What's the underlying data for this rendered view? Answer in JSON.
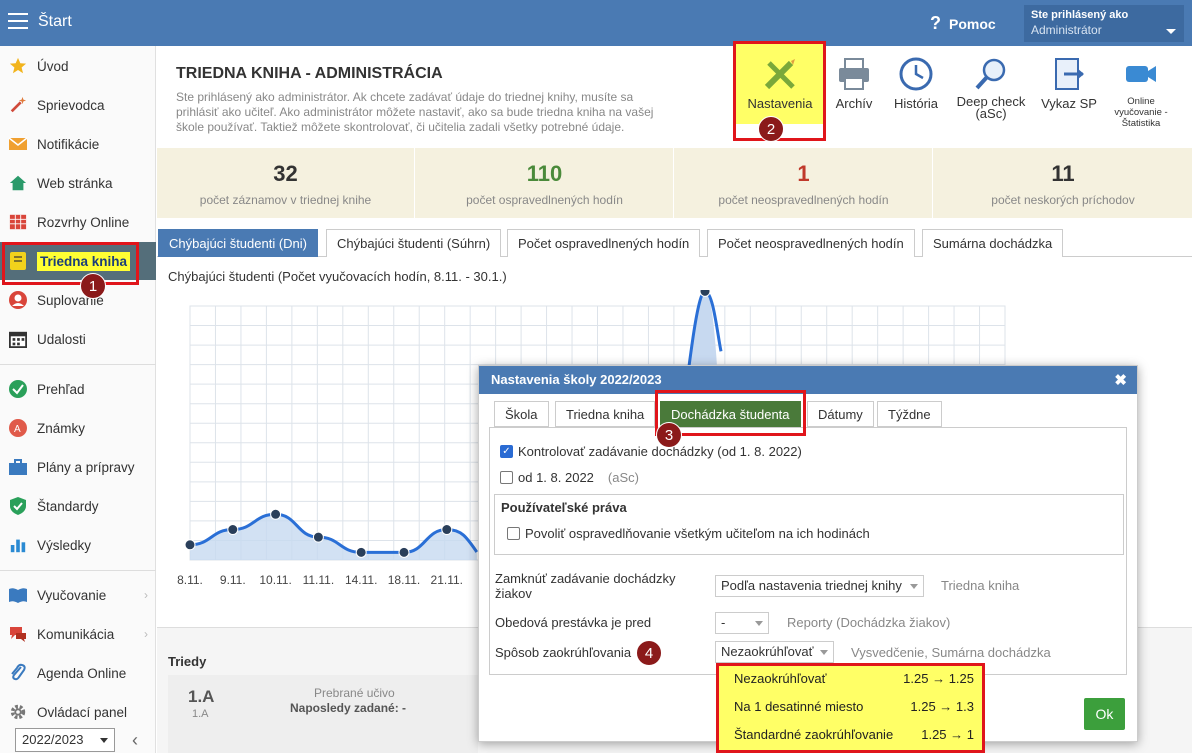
{
  "app": {
    "title": "Štart",
    "help": "Pomoc",
    "user_label": "Ste prihlásený ako",
    "user_role": "Administrátor"
  },
  "sidebar": {
    "items": [
      {
        "label": "Úvod",
        "icon": "star-icon"
      },
      {
        "label": "Sprievodca",
        "icon": "wand-icon"
      },
      {
        "label": "Notifikácie",
        "icon": "envelope-icon"
      },
      {
        "label": "Web stránka",
        "icon": "home-icon"
      },
      {
        "label": "Rozvrhy Online",
        "icon": "calendar-grid-icon"
      },
      {
        "label": "Triedna kniha",
        "icon": "notebook-icon"
      },
      {
        "label": "Suplovanie",
        "icon": "person-icon"
      },
      {
        "label": "Udalosti",
        "icon": "calendar-icon"
      },
      {
        "label": "Prehľad",
        "icon": "check-circle-icon"
      },
      {
        "label": "Známky",
        "icon": "grade-icon"
      },
      {
        "label": "Plány a prípravy",
        "icon": "briefcase-icon"
      },
      {
        "label": "Štandardy",
        "icon": "shield-check-icon"
      },
      {
        "label": "Výsledky",
        "icon": "bar-chart-icon"
      },
      {
        "label": "Vyučovanie",
        "icon": "book-icon"
      },
      {
        "label": "Komunikácia",
        "icon": "chat-icon"
      },
      {
        "label": "Agenda Online",
        "icon": "paperclip-icon"
      },
      {
        "label": "Ovládací panel",
        "icon": "gear-icon"
      }
    ],
    "year": "2022/2023"
  },
  "header": {
    "title": "TRIEDNA KNIHA - ADMINISTRÁCIA",
    "desc1": "Ste prihlásený ako administrátor. Ak chcete zadávať údaje do triednej knihy, musíte sa",
    "desc2": "prihlásiť ako učiteľ. Ako administrátor môžete nastaviť, ako sa bude triedna kniha na vašej",
    "desc3": "škole používať. Taktiež môžete skontrolovať, či učitelia zadali všetky potrebné údaje."
  },
  "toolbar": {
    "settings": "Nastavenia",
    "archive": "Archív",
    "history": "História",
    "deep1": "Deep check",
    "deep2": "(aSc)",
    "report": "Vykaz SP",
    "online1": "Online",
    "online2": "vyučovanie -",
    "online3": "Štatistika"
  },
  "stats": [
    {
      "value": "32",
      "label": "počet záznamov v triednej knihe",
      "color": "#333333"
    },
    {
      "value": "110",
      "label": "počet ospravedlnených hodín",
      "color": "#4a8a3a"
    },
    {
      "value": "1",
      "label": "počet neospravedlnených hodín",
      "color": "#c0392b"
    },
    {
      "value": "11",
      "label": "počet neskorých príchodov",
      "color": "#333333"
    }
  ],
  "tabs": [
    "Chýbajúci študenti (Dni)",
    "Chýbajúci študenti (Súhrn)",
    "Počet ospravedlnených hodín",
    "Počet neospravedlnených hodín",
    "Sumárna dochádzka"
  ],
  "chart_title": "Chýbajúci študenti (Počet vyučovacích hodín, 8.11. - 30.1.)",
  "chart_data": {
    "type": "area",
    "categories": [
      "8.11.",
      "9.11.",
      "10.11.",
      "11.11.",
      "14.11.",
      "18.11.",
      "21.11."
    ],
    "values": [
      1,
      2,
      3,
      1.5,
      0.5,
      0.5,
      2
    ],
    "peak_value": 12.5,
    "grid": true
  },
  "triedy": {
    "title": "Triedy",
    "class_name": "1.A",
    "class_sub": "1.A",
    "lbl1": "Prebrané učivo",
    "lbl2": "Naposledy zadané: -"
  },
  "dialog": {
    "title": "Nastavenia školy 2022/2023",
    "tabs": [
      "Škola",
      "Triedna kniha",
      "Dochádzka študenta",
      "Dátumy",
      "Týždne"
    ],
    "cb1": "Kontrolovať zadávanie dochádzky (od 1. 8. 2022)",
    "cb2": "od 1. 8. 2022",
    "cb2_note": "(aSc)",
    "group_title": "Používateľské práva",
    "cb3": "Povoliť ospravedlňovanie všetkým učiteľom na ich hodinách",
    "lock1": "Zamknúť zadávanie dochádzky",
    "lock2": "žiakov",
    "lock_value": "Podľa nastavenia triednej knihy",
    "lock_note": "Triedna kniha",
    "lunch_label": "Obedová prestávka je pred",
    "lunch_value": "-",
    "lunch_note": "Reporty (Dochádzka žiakov)",
    "round_label": "Spôsob zaokrúhľovania",
    "round_value": "Nezaokrúhľovať",
    "round_note": "Vysvedčenie, Sumárna dochádzka",
    "ok": "Ok"
  },
  "dropdown": [
    {
      "label": "Nezaokrúhľovať",
      "example": "1.25 → 1.25"
    },
    {
      "label": "Na 1 desatinné miesto",
      "example": "1.25 → 1.3"
    },
    {
      "label": "Štandardné zaokrúhľovanie",
      "example": "1.25 → 1"
    }
  ],
  "badges": [
    "1",
    "2",
    "3",
    "4"
  ],
  "colors": {
    "topbar": "#4a7ab3",
    "highlight": "#ffff66",
    "annotation": "#e0151b"
  }
}
